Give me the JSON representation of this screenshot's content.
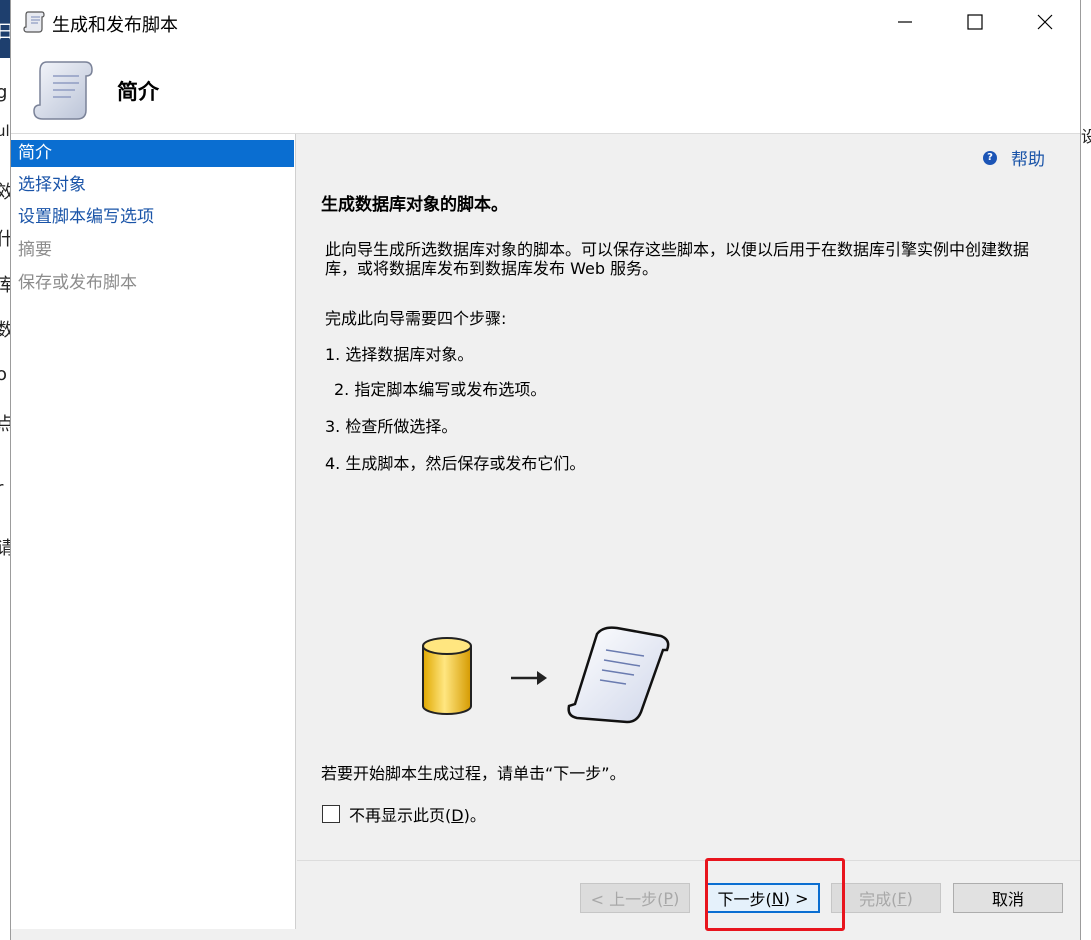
{
  "background": {
    "left_glyphs": [
      "日",
      "g",
      "ul",
      "效",
      "什",
      "库",
      "数",
      "o",
      "点",
      "r",
      "请"
    ],
    "right_glyph": "设"
  },
  "window": {
    "title": "生成和发布脚本",
    "controls": {
      "minimize": "minimize",
      "maximize": "maximize",
      "close": "close"
    }
  },
  "header": {
    "title": "简介"
  },
  "nav": {
    "items": [
      {
        "label": "简介",
        "state": "active"
      },
      {
        "label": "选择对象",
        "state": "link"
      },
      {
        "label": "设置脚本编写选项",
        "state": "link"
      },
      {
        "label": "摘要",
        "state": "disabled"
      },
      {
        "label": "保存或发布脚本",
        "state": "disabled"
      }
    ]
  },
  "content": {
    "help_label": "帮助",
    "heading": "生成数据库对象的脚本。",
    "description": "此向导生成所选数据库对象的脚本。可以保存这些脚本，以便以后用于在数据库引擎实例中创建数据库，或将数据库发布到数据库发布 Web 服务。",
    "steps_intro": "完成此向导需要四个步骤:",
    "steps": [
      "1.  选择数据库对象。",
      "2.  指定脚本编写或发布选项。",
      "3.  检查所做选择。",
      "4.  生成脚本，然后保存或发布它们。"
    ],
    "start_text": "若要开始脚本生成过程，请单击“下一步”。",
    "checkbox": {
      "label_prefix": "不再显示此页(",
      "mnemonic": "D",
      "label_suffix": ")。",
      "checked": false
    }
  },
  "buttons": {
    "previous": {
      "prefix": "< 上一步(",
      "mnemonic": "P",
      "suffix": ")",
      "enabled": false
    },
    "next": {
      "prefix": "下一步(",
      "mnemonic": "N",
      "suffix": ") >",
      "enabled": true
    },
    "finish": {
      "prefix": "完成(",
      "mnemonic": "F",
      "suffix": ")",
      "enabled": false
    },
    "cancel": {
      "label": "取消",
      "enabled": true
    }
  },
  "colors": {
    "accent": "#0a6ed1",
    "link": "#1a54a8",
    "highlight": "#e8141d"
  }
}
